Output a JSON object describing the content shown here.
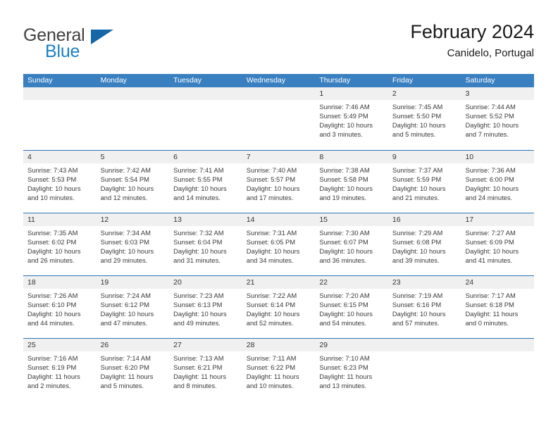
{
  "brand": {
    "word_one": "General",
    "word_two": "Blue",
    "triangle_icon": "brand-triangle-icon",
    "colors": {
      "dark_text": "#3f3f3f",
      "blue_text": "#1b7fc4",
      "triangle": "#1567a8"
    }
  },
  "header": {
    "title": "February 2024",
    "location": "Canidelo, Portugal"
  },
  "theme": {
    "header_blue": "#3a80c1",
    "row_divider_blue": "#2f73b4",
    "band_gray": "#f0f0f0",
    "text": "#3a3a3a"
  },
  "calendar": {
    "day_headers": [
      "Sunday",
      "Monday",
      "Tuesday",
      "Wednesday",
      "Thursday",
      "Friday",
      "Saturday"
    ],
    "weeks": [
      [
        {
          "day": "",
          "empty": true
        },
        {
          "day": "",
          "empty": true
        },
        {
          "day": "",
          "empty": true
        },
        {
          "day": "",
          "empty": true
        },
        {
          "day": "1",
          "sunrise": "Sunrise: 7:46 AM",
          "sunset": "Sunset: 5:49 PM",
          "daylight": "Daylight: 10 hours and 3 minutes."
        },
        {
          "day": "2",
          "sunrise": "Sunrise: 7:45 AM",
          "sunset": "Sunset: 5:50 PM",
          "daylight": "Daylight: 10 hours and 5 minutes."
        },
        {
          "day": "3",
          "sunrise": "Sunrise: 7:44 AM",
          "sunset": "Sunset: 5:52 PM",
          "daylight": "Daylight: 10 hours and 7 minutes."
        }
      ],
      [
        {
          "day": "4",
          "sunrise": "Sunrise: 7:43 AM",
          "sunset": "Sunset: 5:53 PM",
          "daylight": "Daylight: 10 hours and 10 minutes."
        },
        {
          "day": "5",
          "sunrise": "Sunrise: 7:42 AM",
          "sunset": "Sunset: 5:54 PM",
          "daylight": "Daylight: 10 hours and 12 minutes."
        },
        {
          "day": "6",
          "sunrise": "Sunrise: 7:41 AM",
          "sunset": "Sunset: 5:55 PM",
          "daylight": "Daylight: 10 hours and 14 minutes."
        },
        {
          "day": "7",
          "sunrise": "Sunrise: 7:40 AM",
          "sunset": "Sunset: 5:57 PM",
          "daylight": "Daylight: 10 hours and 17 minutes."
        },
        {
          "day": "8",
          "sunrise": "Sunrise: 7:38 AM",
          "sunset": "Sunset: 5:58 PM",
          "daylight": "Daylight: 10 hours and 19 minutes."
        },
        {
          "day": "9",
          "sunrise": "Sunrise: 7:37 AM",
          "sunset": "Sunset: 5:59 PM",
          "daylight": "Daylight: 10 hours and 21 minutes."
        },
        {
          "day": "10",
          "sunrise": "Sunrise: 7:36 AM",
          "sunset": "Sunset: 6:00 PM",
          "daylight": "Daylight: 10 hours and 24 minutes."
        }
      ],
      [
        {
          "day": "11",
          "sunrise": "Sunrise: 7:35 AM",
          "sunset": "Sunset: 6:02 PM",
          "daylight": "Daylight: 10 hours and 26 minutes."
        },
        {
          "day": "12",
          "sunrise": "Sunrise: 7:34 AM",
          "sunset": "Sunset: 6:03 PM",
          "daylight": "Daylight: 10 hours and 29 minutes."
        },
        {
          "day": "13",
          "sunrise": "Sunrise: 7:32 AM",
          "sunset": "Sunset: 6:04 PM",
          "daylight": "Daylight: 10 hours and 31 minutes."
        },
        {
          "day": "14",
          "sunrise": "Sunrise: 7:31 AM",
          "sunset": "Sunset: 6:05 PM",
          "daylight": "Daylight: 10 hours and 34 minutes."
        },
        {
          "day": "15",
          "sunrise": "Sunrise: 7:30 AM",
          "sunset": "Sunset: 6:07 PM",
          "daylight": "Daylight: 10 hours and 36 minutes."
        },
        {
          "day": "16",
          "sunrise": "Sunrise: 7:29 AM",
          "sunset": "Sunset: 6:08 PM",
          "daylight": "Daylight: 10 hours and 39 minutes."
        },
        {
          "day": "17",
          "sunrise": "Sunrise: 7:27 AM",
          "sunset": "Sunset: 6:09 PM",
          "daylight": "Daylight: 10 hours and 41 minutes."
        }
      ],
      [
        {
          "day": "18",
          "sunrise": "Sunrise: 7:26 AM",
          "sunset": "Sunset: 6:10 PM",
          "daylight": "Daylight: 10 hours and 44 minutes."
        },
        {
          "day": "19",
          "sunrise": "Sunrise: 7:24 AM",
          "sunset": "Sunset: 6:12 PM",
          "daylight": "Daylight: 10 hours and 47 minutes."
        },
        {
          "day": "20",
          "sunrise": "Sunrise: 7:23 AM",
          "sunset": "Sunset: 6:13 PM",
          "daylight": "Daylight: 10 hours and 49 minutes."
        },
        {
          "day": "21",
          "sunrise": "Sunrise: 7:22 AM",
          "sunset": "Sunset: 6:14 PM",
          "daylight": "Daylight: 10 hours and 52 minutes."
        },
        {
          "day": "22",
          "sunrise": "Sunrise: 7:20 AM",
          "sunset": "Sunset: 6:15 PM",
          "daylight": "Daylight: 10 hours and 54 minutes."
        },
        {
          "day": "23",
          "sunrise": "Sunrise: 7:19 AM",
          "sunset": "Sunset: 6:16 PM",
          "daylight": "Daylight: 10 hours and 57 minutes."
        },
        {
          "day": "24",
          "sunrise": "Sunrise: 7:17 AM",
          "sunset": "Sunset: 6:18 PM",
          "daylight": "Daylight: 11 hours and 0 minutes."
        }
      ],
      [
        {
          "day": "25",
          "sunrise": "Sunrise: 7:16 AM",
          "sunset": "Sunset: 6:19 PM",
          "daylight": "Daylight: 11 hours and 2 minutes."
        },
        {
          "day": "26",
          "sunrise": "Sunrise: 7:14 AM",
          "sunset": "Sunset: 6:20 PM",
          "daylight": "Daylight: 11 hours and 5 minutes."
        },
        {
          "day": "27",
          "sunrise": "Sunrise: 7:13 AM",
          "sunset": "Sunset: 6:21 PM",
          "daylight": "Daylight: 11 hours and 8 minutes."
        },
        {
          "day": "28",
          "sunrise": "Sunrise: 7:11 AM",
          "sunset": "Sunset: 6:22 PM",
          "daylight": "Daylight: 11 hours and 10 minutes."
        },
        {
          "day": "29",
          "sunrise": "Sunrise: 7:10 AM",
          "sunset": "Sunset: 6:23 PM",
          "daylight": "Daylight: 11 hours and 13 minutes."
        },
        {
          "day": "",
          "empty": true
        },
        {
          "day": "",
          "empty": true
        }
      ]
    ]
  }
}
